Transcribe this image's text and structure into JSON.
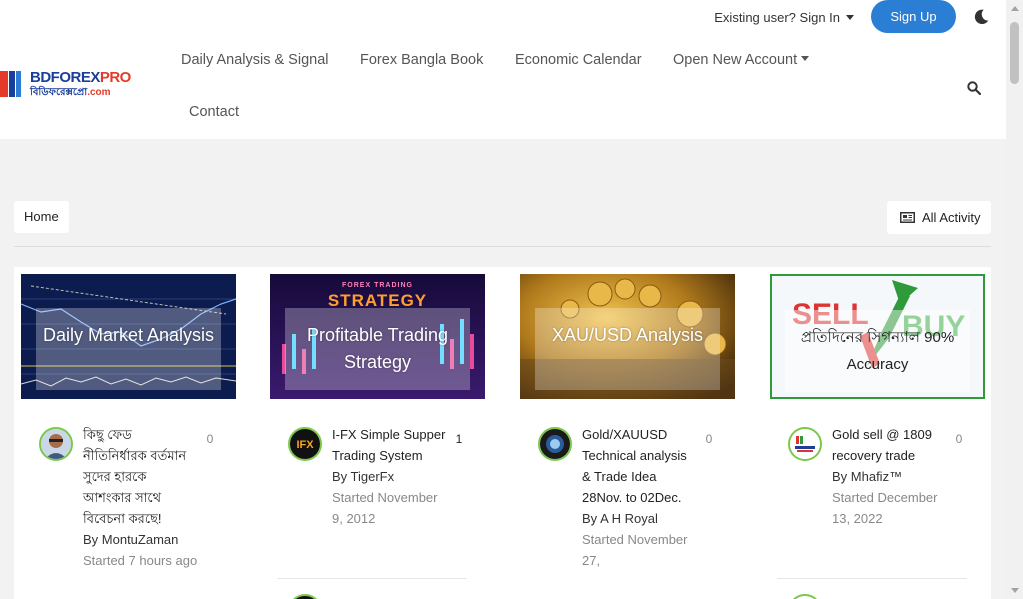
{
  "topbar": {
    "signin_label": "Existing user? Sign In",
    "signup_label": "Sign Up"
  },
  "logo": {
    "line1_a": "BDFOREX",
    "line1_b": "PRO",
    "line2_a": "বিডিফরেক্সপ্রো",
    "line2_b": ".com"
  },
  "nav": {
    "items": [
      "Daily Analysis & Signal",
      "Forex Bangla Book",
      "Economic Calendar",
      "Open New Account",
      "Contact"
    ]
  },
  "breadcrumb": {
    "home": "Home"
  },
  "activity_label": "All Activity",
  "colors": {
    "accent": "#2a7fd4",
    "avatar_ring": "#7cc84a"
  },
  "cards": [
    {
      "thumb_label": "Daily Market Analysis",
      "topic_title": "কিছু ফেড নীতিনির্ধারক বর্তমান সুদের হারকে আশংকার সাথে বিবেচনা করছে!",
      "author": "By MontuZaman",
      "started": "Started 7 hours ago",
      "count": "0"
    },
    {
      "thumb_label": "Profitable Trading Strategy",
      "thumb_banner_1": "FOREX TRADING",
      "thumb_banner_2": "STRATEGY",
      "topic_title": "I-FX Simple Supper Trading System",
      "author": "By TigerFx",
      "started": "Started November 9, 2012",
      "count": "1"
    },
    {
      "thumb_label": "XAU/USD Analysis",
      "topic_title": "Gold/XAUUSD Technical analysis & Trade Idea 28Nov. to 02Dec.",
      "author": "By A H Royal",
      "started": "Started November 27,",
      "count": "0"
    },
    {
      "thumb_label": "প্রতিদিনের সিগন্যাল 90% Accuracy",
      "thumb_sell": "SELL",
      "thumb_buy": "BUY",
      "topic_title": "Gold sell @ 1809 recovery trade",
      "author": "By Mhafiz™",
      "started": "Started December 13, 2022",
      "count": "0"
    }
  ]
}
